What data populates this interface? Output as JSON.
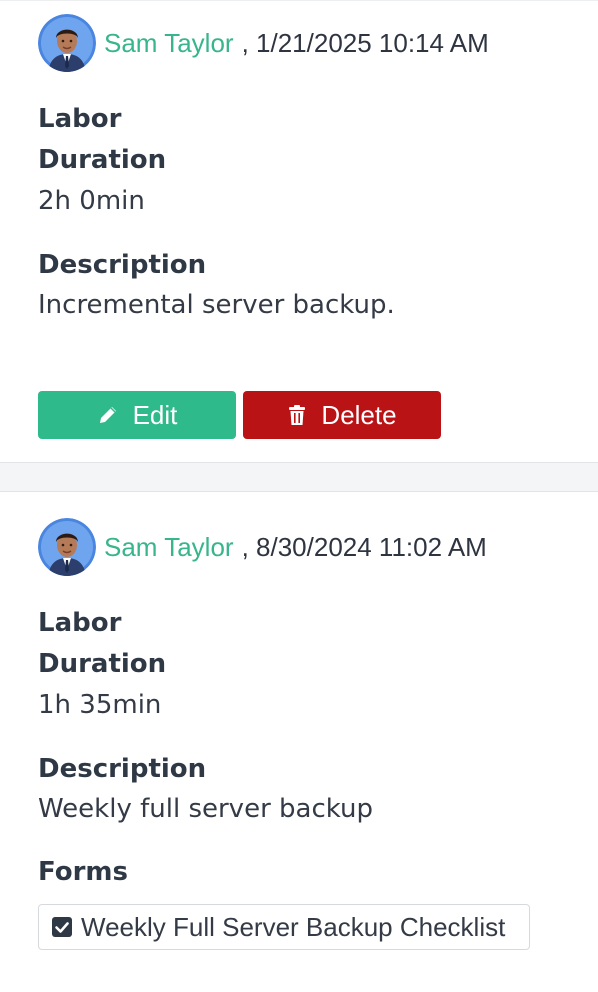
{
  "entries": [
    {
      "author": "Sam Taylor",
      "separator_date": ", 1/21/2025 10:14 AM",
      "type_label": "Labor",
      "duration_label": "Duration",
      "duration_value": "2h 0min",
      "description_label": "Description",
      "description_value": "Incremental server backup.",
      "actions": {
        "edit_label": "Edit",
        "delete_label": "Delete"
      }
    },
    {
      "author": "Sam Taylor",
      "separator_date": ", 8/30/2024 11:02 AM",
      "type_label": "Labor",
      "duration_label": "Duration",
      "duration_value": "1h 35min",
      "description_label": "Description",
      "description_value": "Weekly full server backup",
      "forms_label": "Forms",
      "forms": [
        {
          "name": "Weekly Full Server Backup Checklist",
          "icon": "checkbox-checked-icon"
        }
      ]
    }
  ],
  "colors": {
    "author_link": "#38b58d",
    "edit_button": "#2fba8c",
    "delete_button": "#b91316"
  },
  "icons": {
    "edit": "pencil-icon",
    "delete": "trash-icon",
    "avatar": "avatar"
  }
}
